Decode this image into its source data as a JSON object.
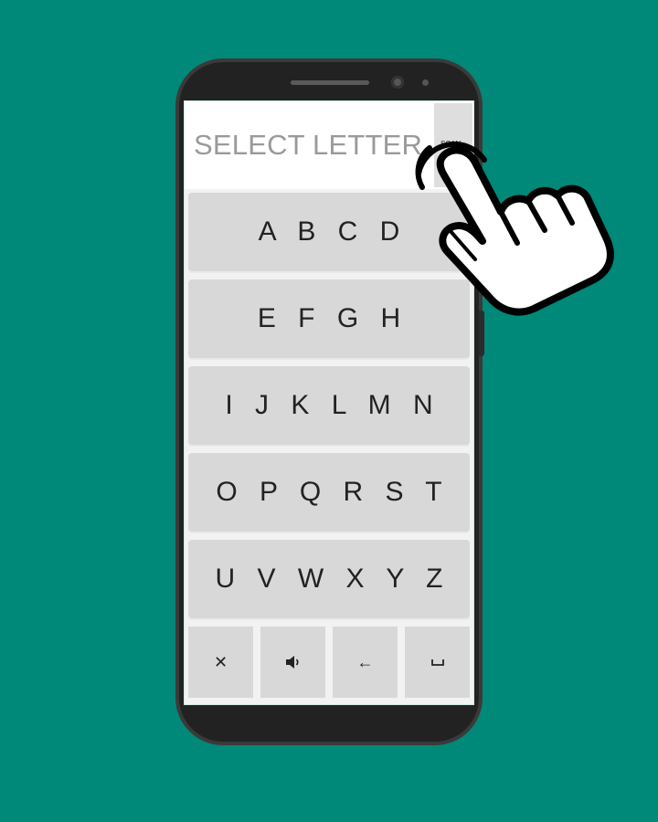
{
  "header": {
    "title": "SELECT LETTER",
    "scan_label": "SCAN"
  },
  "letter_rows": [
    {
      "label": "A B C D"
    },
    {
      "label": "E F G H"
    },
    {
      "label": "I J K L M N"
    },
    {
      "label": "O P Q R S T"
    },
    {
      "label": "U V W X Y Z"
    }
  ],
  "bottom_bar": {
    "clear": "✕",
    "speak": "🔊",
    "backspace": "←",
    "space": "␣"
  },
  "icons": {
    "hand": "pointing-hand-icon",
    "clear": "close-icon",
    "speak": "speaker-icon",
    "backspace": "backspace-arrow-icon",
    "space": "space-bar-icon"
  },
  "colors": {
    "background": "#008878",
    "phone": "#222222",
    "button": "#d8d8d8",
    "title_text": "#9a9a9a"
  }
}
